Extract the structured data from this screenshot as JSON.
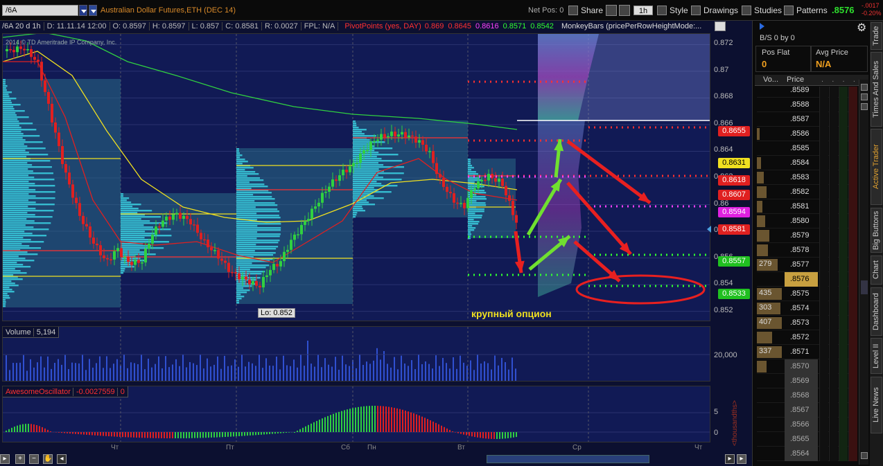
{
  "toolbar": {
    "symbol": "/6A",
    "description": "Australian Dollar Futures,ETH (DEC 14)",
    "net_pos": "Net Pos: 0",
    "share": "Share",
    "interval": "1h",
    "style": "Style",
    "drawings": "Drawings",
    "studies": "Studies",
    "patterns": "Patterns",
    "last": ".8576",
    "change_abs": "-.0017",
    "change_pct": "-0.20%"
  },
  "chart": {
    "header": [
      "/6A 20 d 1h",
      "D: 11.11.14 12:00",
      "O: 0.8597",
      "H: 0.8597",
      "L: 0.857",
      "C: 0.8581",
      "R: 0.0027",
      "FPL: N/A"
    ],
    "pivot_label": "PivotPoints (yes, DAY)",
    "pivot_values": [
      {
        "v": "0.869",
        "color": "#ff3030"
      },
      {
        "v": "0.8645",
        "color": "#ff3030"
      },
      {
        "v": "0.8616",
        "color": "#ff40ff"
      },
      {
        "v": "0.8571",
        "color": "#30ff30"
      },
      {
        "v": "0.8542",
        "color": "#30ff30"
      }
    ],
    "monkeybars": "MonkeyBars (pricePerRowHeightMode:...",
    "watermark": "2014 © TD Ameritrade IP Company, Inc.",
    "lo_label": "Lo: 0.852",
    "annotation": "крупный опцион",
    "price_ticks": [
      "0.872",
      "0.87",
      "0.868",
      "0.866",
      "0.864",
      "0.862",
      "0.86",
      "0.858",
      "0.856",
      "0.854",
      "0.852"
    ],
    "price_boxes": [
      {
        "v": "0.8655",
        "color": "#e02020",
        "p": 0.8655
      },
      {
        "v": "0.8631",
        "color": "#f0e020",
        "p": 0.8631
      },
      {
        "v": "0.8618",
        "color": "#e02020",
        "p": 0.8618
      },
      {
        "v": "0.8607",
        "color": "#e02020",
        "p": 0.8607
      },
      {
        "v": "0.8594",
        "color": "#e020e0",
        "p": 0.8594
      },
      {
        "v": "0.8581",
        "color": "#e02020",
        "p": 0.8581
      },
      {
        "v": "0.8557",
        "color": "#20c020",
        "p": 0.8557
      },
      {
        "v": "0.8533",
        "color": "#20c020",
        "p": 0.8533
      }
    ],
    "x_labels": [
      "Чт",
      "Пт",
      "Сб",
      "Пн",
      "Вт",
      "Ср",
      "Чт"
    ],
    "volume_label": "Volume",
    "volume_value": "5,194",
    "volume_tick": "20,000",
    "ao_label": "AwesomeOscillator",
    "ao_value": "-0.0027559",
    "ao_zero": "0",
    "ao_ticks": [
      "5",
      "0"
    ],
    "ao_unit": "<thousandths>"
  },
  "panel": {
    "bs": "B/S 0 by 0",
    "pos_label": "Pos Flat",
    "pos_value": "0",
    "avg_label": "Avg Price",
    "avg_value": "N/A",
    "col_vol": "Vo...",
    "col_price": "Price",
    "ladder": [
      {
        "price": ".8589",
        "vol": ""
      },
      {
        "price": ".8588",
        "vol": ""
      },
      {
        "price": ".8587",
        "vol": ""
      },
      {
        "price": ".8586",
        "vol": ""
      },
      {
        "price": ".8585",
        "vol": ""
      },
      {
        "price": ".8584",
        "vol": ""
      },
      {
        "price": ".8583",
        "vol": ""
      },
      {
        "price": ".8582",
        "vol": ""
      },
      {
        "price": ".8581",
        "vol": ""
      },
      {
        "price": ".8580",
        "vol": ""
      },
      {
        "price": ".8579",
        "vol": ""
      },
      {
        "price": ".8578",
        "vol": ""
      },
      {
        "price": ".8577",
        "vol": "279"
      },
      {
        "price": ".8576",
        "vol": ""
      },
      {
        "price": ".8575",
        "vol": "435"
      },
      {
        "price": ".8574",
        "vol": "303"
      },
      {
        "price": ".8573",
        "vol": "407"
      },
      {
        "price": ".8572",
        "vol": ""
      },
      {
        "price": ".8571",
        "vol": "337"
      },
      {
        "price": ".8570",
        "vol": ""
      },
      {
        "price": ".8569",
        "vol": ""
      },
      {
        "price": ".8568",
        "vol": ""
      },
      {
        "price": ".8567",
        "vol": ""
      },
      {
        "price": ".8566",
        "vol": ""
      },
      {
        "price": ".8565",
        "vol": ""
      },
      {
        "price": ".8564",
        "vol": ""
      }
    ]
  },
  "side_tabs": [
    "Trade",
    "Times And Sales",
    "Active Trader",
    "Big Buttons",
    "Chart",
    "Dashboard",
    "Level II",
    "Live News"
  ]
}
